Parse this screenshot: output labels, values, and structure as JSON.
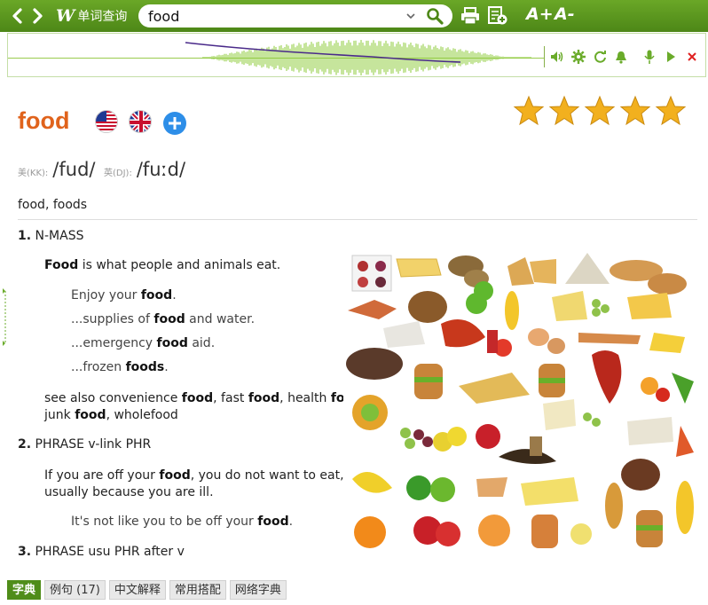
{
  "toolbar": {
    "brand_letter": "W",
    "brand_text": "单词查询",
    "search_value": "food",
    "font_larger": "A+",
    "font_smaller": "A-"
  },
  "entry": {
    "headword": "food",
    "rating_stars": 5,
    "pron_us_label": "美(KK):",
    "pron_us": "/fud/",
    "pron_uk_label": "英(DJ):",
    "pron_uk": "/fuːd/",
    "forms": "food, foods"
  },
  "senses": [
    {
      "num": "1.",
      "title": "N-MASS",
      "def_pre": "",
      "def_word": "Food",
      "def_post": " is what people and animals eat.",
      "examples": [
        {
          "pre": "Enjoy your ",
          "word": "food",
          "post": "."
        },
        {
          "pre": "...supplies of ",
          "word": "food",
          "post": " and water."
        },
        {
          "pre": "...emergency ",
          "word": "food",
          "post": " aid."
        },
        {
          "pre": "...frozen ",
          "word": "foods",
          "post": "."
        }
      ],
      "see_also": {
        "lead": "see also convenience ",
        "w1": "food",
        "t1": ", fast ",
        "w2": "food",
        "t2": ", health ",
        "w3": "food",
        "t3": ",",
        "line2_lead": "junk ",
        "w4": "food",
        "t4": ", wholefood"
      }
    },
    {
      "num": "2.",
      "title": "PHRASE v-link PHR",
      "def_pre": "If you are off your ",
      "def_word": "food",
      "def_post": ", you do not want to eat,",
      "def_line2": "usually because you are ill.",
      "examples": [
        {
          "pre": "It's not like you to be off your ",
          "word": "food",
          "post": "."
        }
      ]
    },
    {
      "num": "3.",
      "title": "PHRASE usu PHR after v"
    }
  ],
  "tabs": [
    {
      "label": "字典"
    },
    {
      "label": "例句 (17)"
    },
    {
      "label": "中文解释"
    },
    {
      "label": "常用搭配"
    },
    {
      "label": "网络字典"
    }
  ],
  "colors": {
    "toolbar_green": "#5a9a1f",
    "headword_orange": "#e0631c",
    "star_gold": "#f2b01e",
    "tab_active": "#4f8d19"
  }
}
